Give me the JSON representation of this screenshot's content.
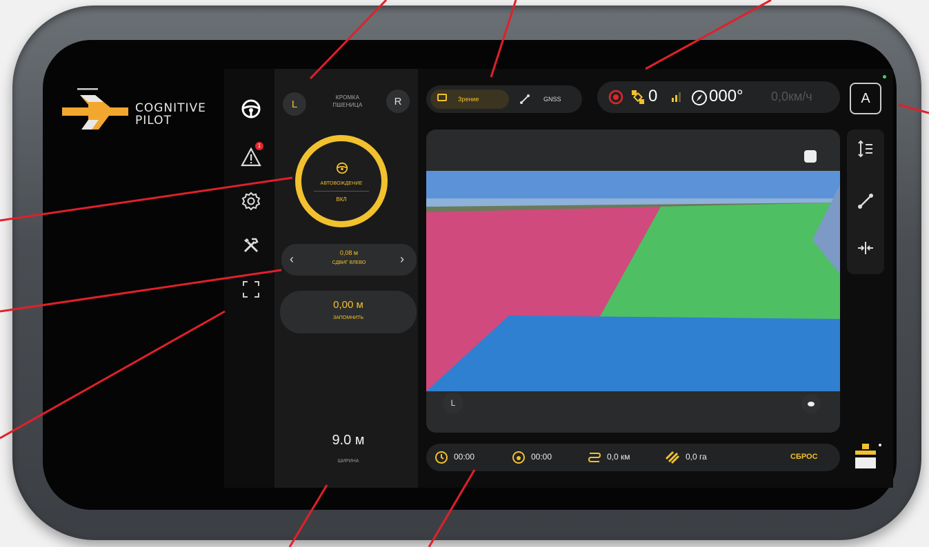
{
  "brand": {
    "line1": "COGNITIVE",
    "line2": "PILOT"
  },
  "sidebar": {
    "items": [
      {
        "icon": "steering-wheel-icon"
      },
      {
        "icon": "warning-icon",
        "badge": "1"
      },
      {
        "icon": "gear-icon"
      },
      {
        "icon": "tools-icon"
      },
      {
        "icon": "fullscreen-icon"
      }
    ]
  },
  "edge": {
    "left_btn": "L",
    "title_line1": "КРОМКА",
    "title_line2": "ПШЕНИЦА",
    "right_btn": "R"
  },
  "autodrive": {
    "label": "АВТОВОЖДЕНИЕ",
    "state": "ВКЛ"
  },
  "offset": {
    "value": "0,08 м",
    "label": "СДВИГ ВЛЕВО",
    "prev": "‹",
    "next": "›"
  },
  "memory": {
    "value": "0,00 м",
    "label": "ЗАПОМНИТЬ"
  },
  "width": {
    "value": "9.0 м",
    "label": "ШИРИНА"
  },
  "mode_tabs": [
    {
      "label": "Зрение",
      "active": true,
      "icon": "camera-icon"
    },
    {
      "label": "GNSS",
      "active": false,
      "icon": "gnss-icon"
    }
  ],
  "status": {
    "satellites": "0",
    "heading": "000°",
    "speed": "0,0км/ч"
  },
  "auto_btn": "A",
  "camera": {
    "left_marker": "L",
    "colors": {
      "sky": "#5c93d8",
      "red_zone": "#d14a7e",
      "green_zone": "#4fbf64",
      "blue_zone": "#2f80d0"
    }
  },
  "stats": {
    "time1": "00:00",
    "time2": "00:00",
    "distance": "0,0 км",
    "area": "0,0 га",
    "reset": "СБРОС"
  },
  "accent": "#f2c12e",
  "annotation_color": "#e0202a"
}
